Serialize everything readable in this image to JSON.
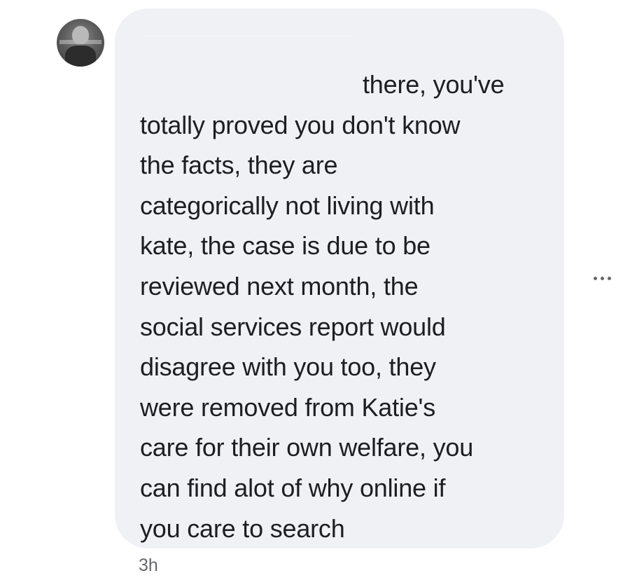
{
  "comment": {
    "author_avatar": "avatar-photo",
    "text_lines": [
      "there, you've",
      "totally proved you don't know",
      "the facts, they are",
      "categorically not living with",
      "kate, the case is due to be",
      "reviewed next month, the",
      "social services report would",
      "disagree with you too, they",
      "were removed from Katie's",
      "care for their own welfare, you",
      "can find alot of why online if",
      "you care to search"
    ],
    "timestamp": "3h",
    "more_icon": "more-options-icon"
  },
  "colors": {
    "bubble_background": "#f0f1f5",
    "text": "#1c1e21",
    "secondary_text": "#65676b",
    "page_background": "#ffffff"
  }
}
